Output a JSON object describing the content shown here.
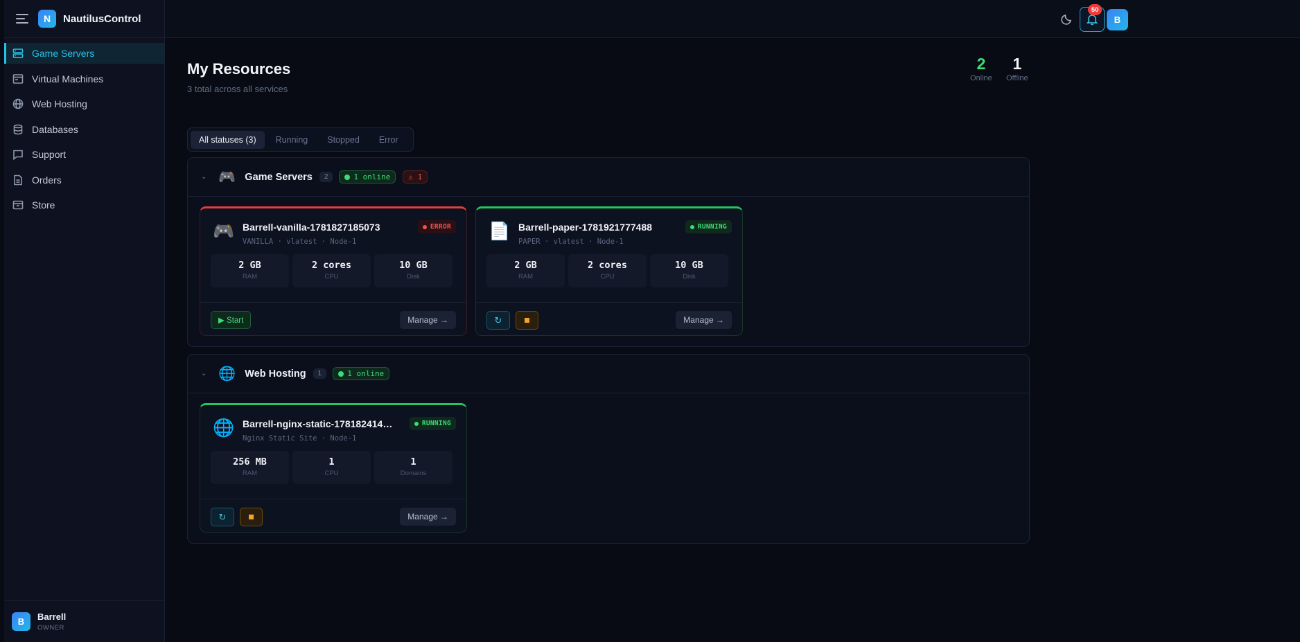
{
  "app": {
    "name": "NautilusControl",
    "logo_letter": "N"
  },
  "sidebar": {
    "items": [
      {
        "label": "Game Servers",
        "icon": "server-icon",
        "active": true
      },
      {
        "label": "Virtual Machines",
        "icon": "monitor-icon"
      },
      {
        "label": "Web Hosting",
        "icon": "globe-icon"
      },
      {
        "label": "Databases",
        "icon": "database-icon"
      },
      {
        "label": "Support",
        "icon": "chat-icon"
      },
      {
        "label": "Orders",
        "icon": "document-icon"
      },
      {
        "label": "Store",
        "icon": "store-icon"
      }
    ],
    "user": {
      "avatar_letter": "B",
      "name": "Barrell",
      "role": "OWNER"
    }
  },
  "topbar": {
    "notification_count": "50",
    "avatar_letter": "B"
  },
  "page": {
    "title": "My Resources",
    "subtitle": "3 total across all services",
    "online_count": "2",
    "online_label": "Online",
    "offline_count": "1",
    "offline_label": "Offline"
  },
  "filters": [
    "All statuses (3)",
    "Running",
    "Stopped",
    "Error"
  ],
  "groups": {
    "game": {
      "title": "Game Servers",
      "count": "2",
      "online": "1 online",
      "errors": "⚠ 1",
      "cards": [
        {
          "name": "Barrell-vanilla-1781827185073",
          "meta": "VANILLA · vlatest · Node-1",
          "status": "ERROR",
          "specs": [
            {
              "value": "2 GB",
              "label": "RAM"
            },
            {
              "value": "2 cores",
              "label": "CPU"
            },
            {
              "value": "10 GB",
              "label": "Disk"
            }
          ],
          "start_label": "▶ Start",
          "manage_label": "Manage →"
        },
        {
          "name": "Barrell-paper-1781921777488",
          "meta": "PAPER · vlatest · Node-1",
          "status": "RUNNING",
          "specs": [
            {
              "value": "2 GB",
              "label": "RAM"
            },
            {
              "value": "2 cores",
              "label": "CPU"
            },
            {
              "value": "10 GB",
              "label": "Disk"
            }
          ],
          "restart_label": "↻",
          "manage_label": "Manage →"
        }
      ]
    },
    "web": {
      "title": "Web Hosting",
      "count": "1",
      "online": "1 online",
      "cards": [
        {
          "name": "Barrell-nginx-static-1781824147...",
          "meta": "Nginx Static Site · Node-1",
          "status": "RUNNING",
          "specs": [
            {
              "value": "256 MB",
              "label": "RAM"
            },
            {
              "value": "1",
              "label": "CPU"
            },
            {
              "value": "1",
              "label": "Domains"
            }
          ],
          "restart_label": "↻",
          "manage_label": "Manage →"
        }
      ]
    }
  },
  "colors": {
    "accent": "#22c2e6",
    "online": "#3ddc78",
    "error": "#f05252",
    "warning": "#f5a524"
  }
}
